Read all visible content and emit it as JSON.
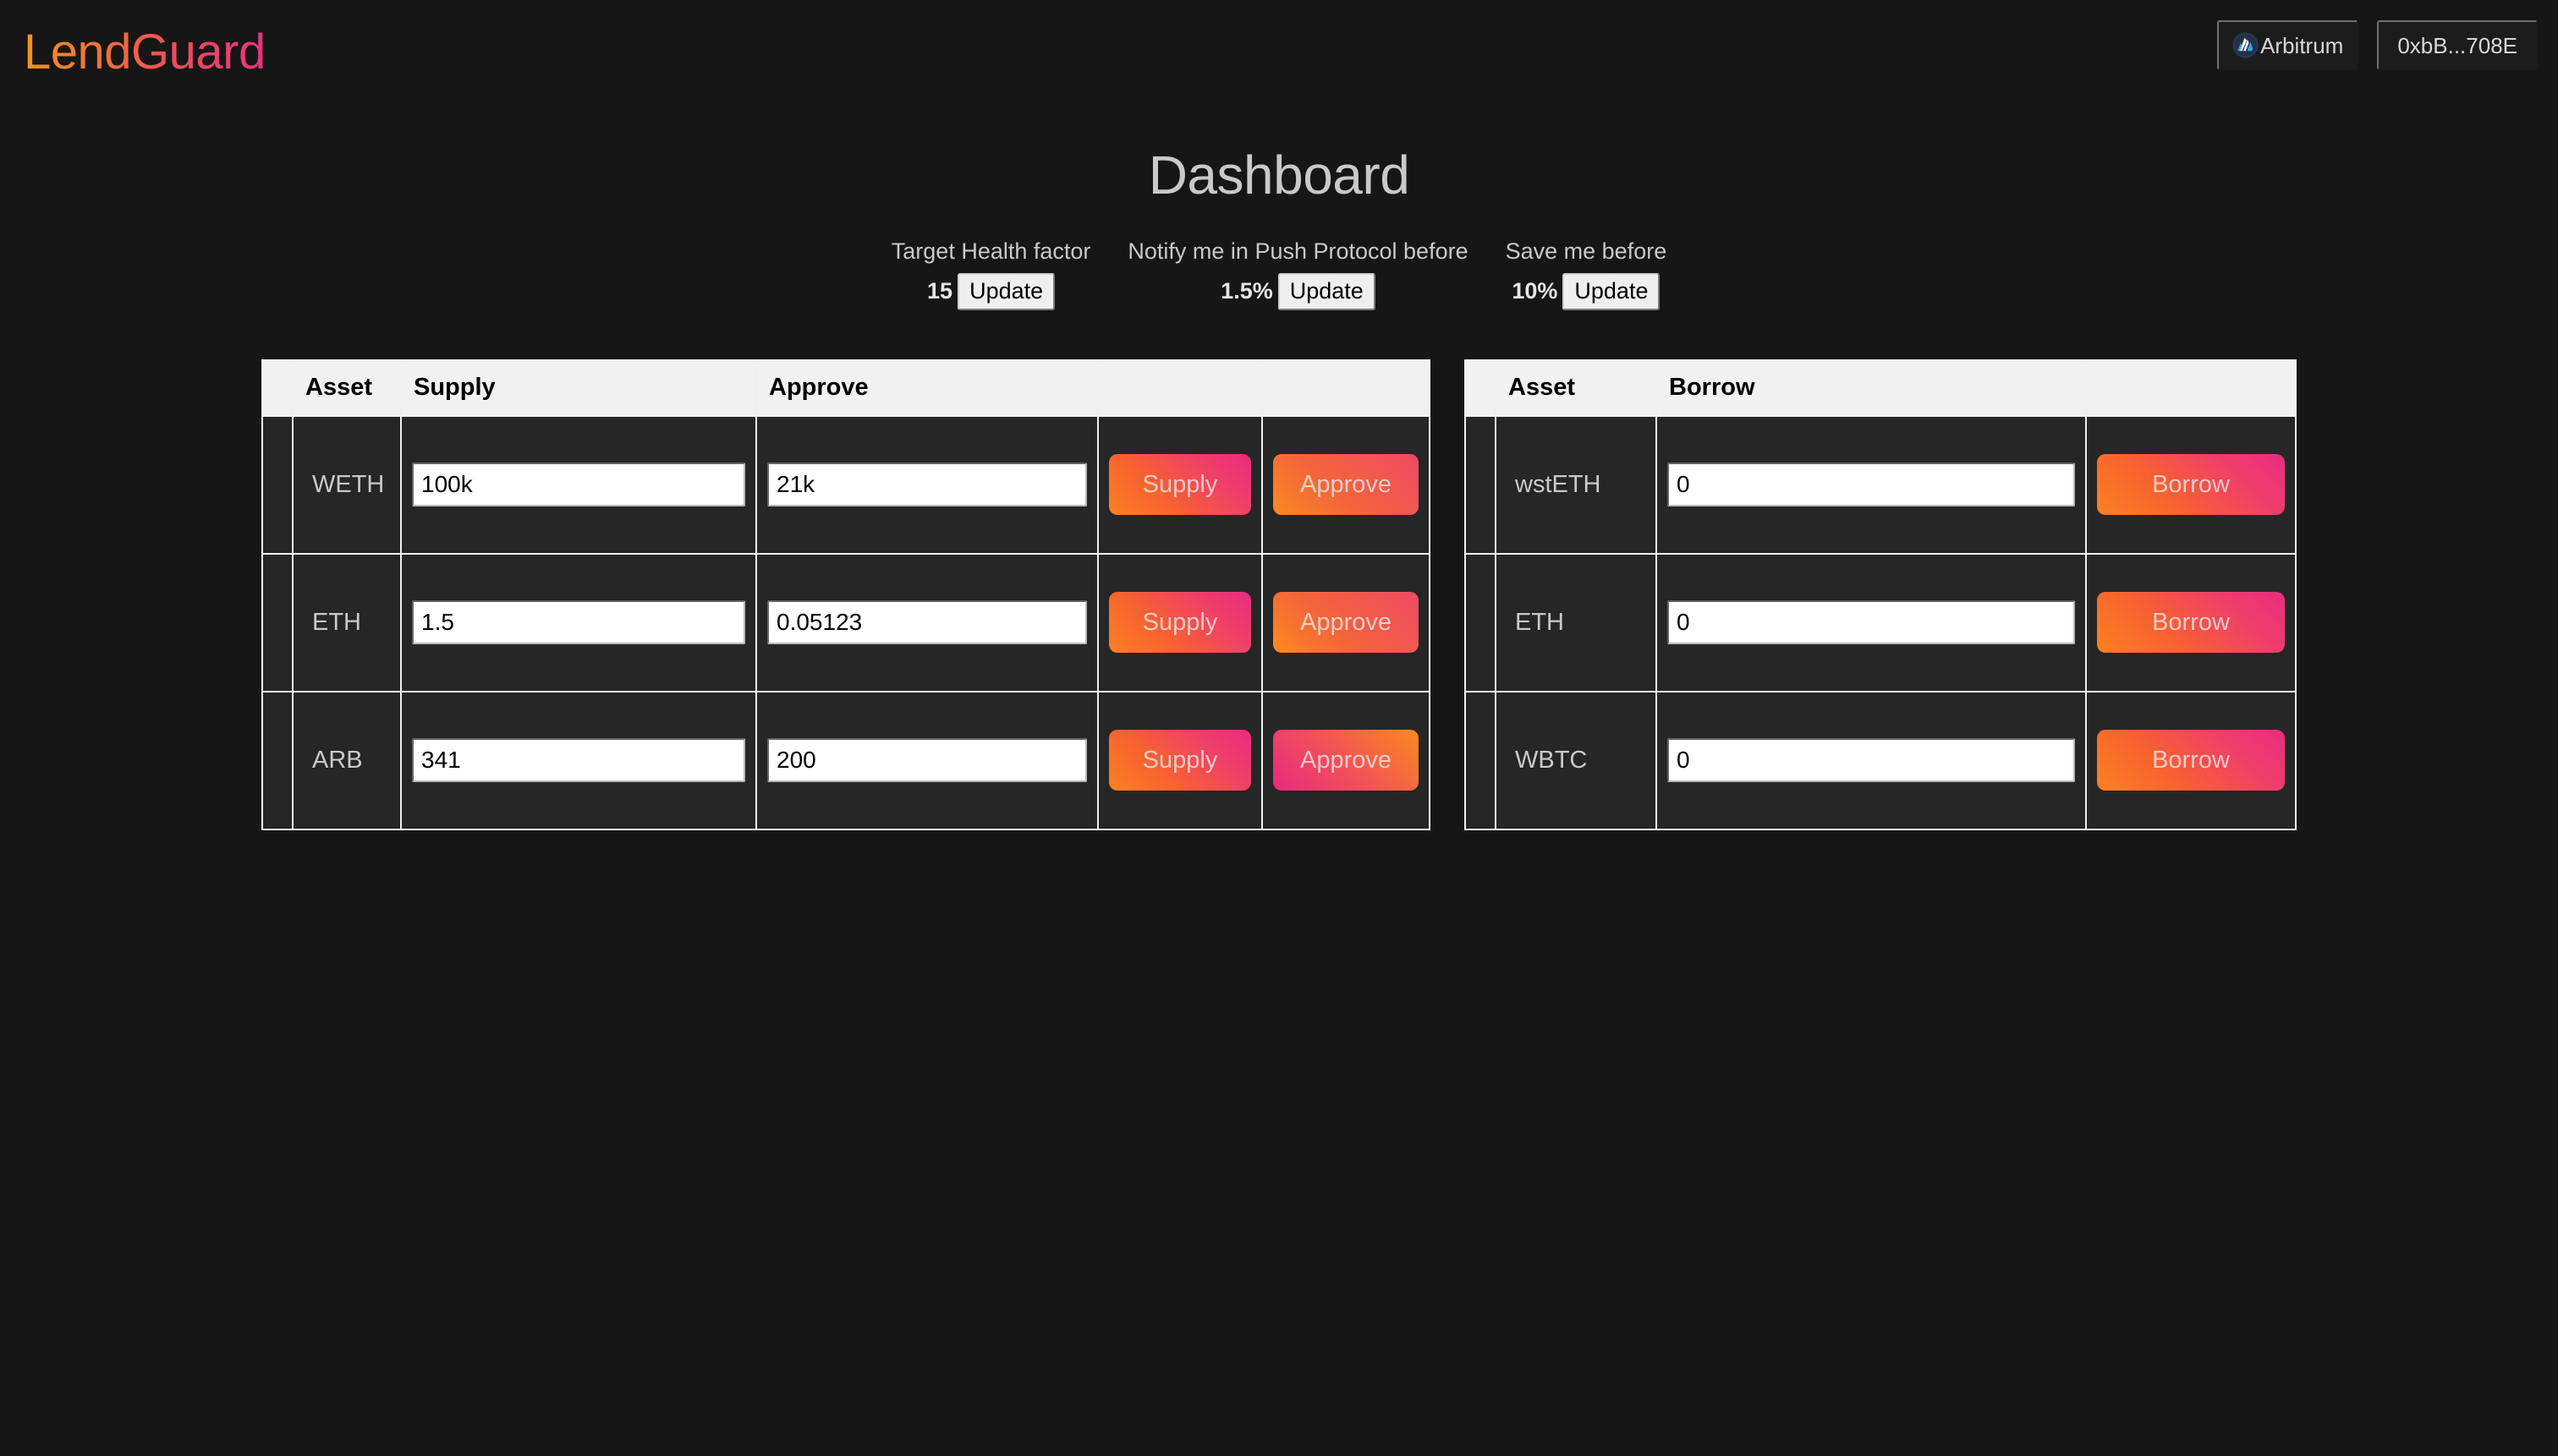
{
  "brand": {
    "name": "LendGuard"
  },
  "topbar": {
    "chain": {
      "label": "Arbitrum",
      "icon": "arbitrum-icon"
    },
    "account": {
      "label": "0xbB...708E"
    }
  },
  "page": {
    "title": "Dashboard"
  },
  "settings": [
    {
      "label": "Target Health factor",
      "value": "15",
      "button": "Update"
    },
    {
      "label": "Notify me in Push Protocol before",
      "value": "1.5%",
      "button": "Update"
    },
    {
      "label": "Save me before",
      "value": "10%",
      "button": "Update"
    }
  ],
  "supply_table": {
    "headers": [
      "",
      "Asset",
      "Supply",
      "Approve",
      "",
      ""
    ],
    "rows": [
      {
        "asset": "WETH",
        "supply_value": "100k",
        "approve_value": "21k",
        "supply_button": "Supply",
        "approve_button": "Approve"
      },
      {
        "asset": "ETH",
        "supply_value": "1.5",
        "approve_value": "0.05123",
        "supply_button": "Supply",
        "approve_button": "Approve"
      },
      {
        "asset": "ARB",
        "supply_value": "341",
        "approve_value": "200",
        "supply_button": "Supply",
        "approve_button": "Approve"
      }
    ]
  },
  "borrow_table": {
    "headers": [
      "",
      "Asset",
      "Borrow",
      ""
    ],
    "rows": [
      {
        "asset": "wstETH",
        "borrow_value": "0",
        "borrow_button": "Borrow"
      },
      {
        "asset": "ETH",
        "borrow_value": "0",
        "borrow_button": "Borrow"
      },
      {
        "asset": "WBTC",
        "borrow_value": "0",
        "borrow_button": "Borrow"
      }
    ]
  },
  "colors": {
    "background": "#161616",
    "cell_background": "#262626",
    "header_background": "#f1f1f1",
    "accent_orange": "#fb8122",
    "accent_pink": "#ea2b80",
    "text_light": "#c9c9c9"
  }
}
